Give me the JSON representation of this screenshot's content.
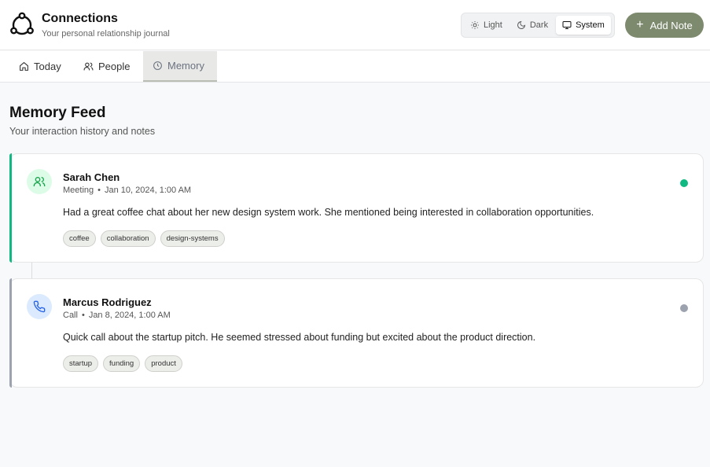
{
  "app": {
    "title": "Connections",
    "subtitle": "Your personal relationship journal",
    "logo_icon": "connections-logo-icon"
  },
  "theme": {
    "options": [
      {
        "label": "Light",
        "icon": "sun-icon"
      },
      {
        "label": "Dark",
        "icon": "moon-icon"
      },
      {
        "label": "System",
        "icon": "monitor-icon"
      }
    ],
    "active": "System"
  },
  "add_note": {
    "label": "Add Note",
    "color": "#7d8a6e"
  },
  "tabs": [
    {
      "label": "Today",
      "icon": "home-icon"
    },
    {
      "label": "People",
      "icon": "users-icon"
    },
    {
      "label": "Memory",
      "icon": "clock-icon"
    }
  ],
  "active_tab": "Memory",
  "feed": {
    "title": "Memory Feed",
    "subtitle": "Your interaction history and notes",
    "entries": [
      {
        "name": "Sarah Chen",
        "type": "Meeting",
        "date": "Jan 10, 2024, 1:00 AM",
        "note": "Had a great coffee chat about her new design system work. She mentioned being interested in collaboration opportunities.",
        "tags": [
          "coffee",
          "collaboration",
          "design-systems"
        ],
        "icon": "users-icon",
        "accent_color": "#10b981",
        "status_color": "#10b981"
      },
      {
        "name": "Marcus Rodriguez",
        "type": "Call",
        "date": "Jan 8, 2024, 1:00 AM",
        "note": "Quick call about the startup pitch. He seemed stressed about funding but excited about the product direction.",
        "tags": [
          "startup",
          "funding",
          "product"
        ],
        "icon": "phone-icon",
        "accent_color": "#9ca3af",
        "status_color": "#9ca3af"
      }
    ]
  }
}
